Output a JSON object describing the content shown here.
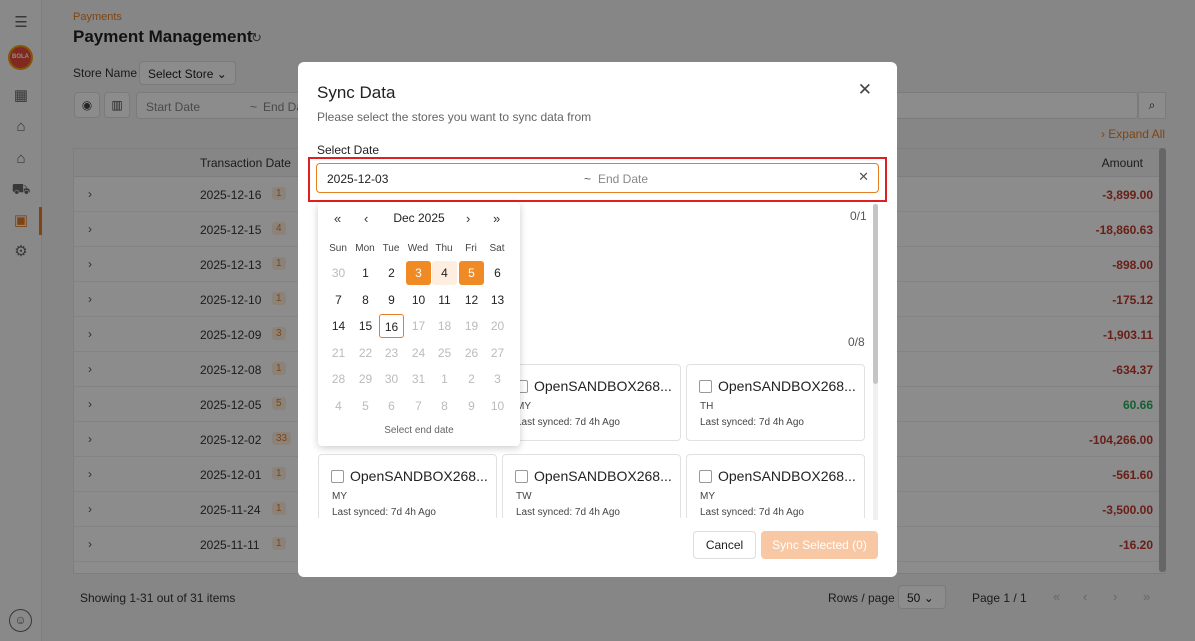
{
  "breadcrumb": "Payments",
  "page_title": "Payment Management",
  "filter": {
    "label": "Store Name",
    "select": "Select Store"
  },
  "date_filter": {
    "start": "Start Date",
    "sep": "~",
    "end": "End Da"
  },
  "expand_all": "Expand All",
  "table": {
    "headers": {
      "date": "Transaction Date",
      "amount": "Amount"
    },
    "rows": [
      {
        "date": "2025-12-16",
        "count": "1",
        "amount": "-3,899.00"
      },
      {
        "date": "2025-12-15",
        "count": "4",
        "amount": "-18,860.63"
      },
      {
        "date": "2025-12-13",
        "count": "1",
        "amount": "-898.00"
      },
      {
        "date": "2025-12-10",
        "count": "1",
        "amount": "-175.12"
      },
      {
        "date": "2025-12-09",
        "count": "3",
        "amount": "-1,903.11"
      },
      {
        "date": "2025-12-08",
        "count": "1",
        "amount": "-634.37"
      },
      {
        "date": "2025-12-05",
        "count": "5",
        "amount": "60.66"
      },
      {
        "date": "2025-12-02",
        "count": "33",
        "amount": "-104,266.00"
      },
      {
        "date": "2025-12-01",
        "count": "1",
        "amount": "-561.60"
      },
      {
        "date": "2025-11-24",
        "count": "1",
        "amount": "-3,500.00"
      },
      {
        "date": "2025-11-11",
        "count": "1",
        "amount": "-16.20"
      }
    ]
  },
  "footer": {
    "showing": "Showing 1-31 out of 31 items",
    "rows_label": "Rows / page",
    "rows_value": "50",
    "page": "Page 1 / 1"
  },
  "modal": {
    "title": "Sync Data",
    "subtitle": "Please select the stores you want to sync data from",
    "date_label": "Select Date",
    "date_start": "2025-12-03",
    "date_sep": "~",
    "date_end_placeholder": "End Date",
    "count1": "0/1",
    "count2": "0/8",
    "stores": [
      {
        "name": "OpenSANDBOX268...",
        "country": "MY",
        "sync": "Last synced: 7d 4h Ago"
      },
      {
        "name": "OpenSANDBOX268...",
        "country": "TH",
        "sync": "Last synced: 7d 4h Ago"
      },
      {
        "name": "OpenSANDBOX268...",
        "country": "MY",
        "sync": "Last synced: 7d 4h Ago"
      },
      {
        "name": "OpenSANDBOX268...",
        "country": "TW",
        "sync": "Last synced: 7d 4h Ago"
      },
      {
        "name": "OpenSANDBOX268...",
        "country": "MY",
        "sync": "Last synced: 7d 4h Ago"
      }
    ],
    "cancel": "Cancel",
    "sync_button": "Sync Selected (0)"
  },
  "calendar": {
    "month": "Dec 2025",
    "dow": [
      "Sun",
      "Mon",
      "Tue",
      "Wed",
      "Thu",
      "Fri",
      "Sat"
    ],
    "weeks": [
      [
        "30",
        "1",
        "2",
        "3",
        "4",
        "5",
        "6"
      ],
      [
        "7",
        "8",
        "9",
        "10",
        "11",
        "12",
        "13"
      ],
      [
        "14",
        "15",
        "16",
        "17",
        "18",
        "19",
        "20"
      ],
      [
        "21",
        "22",
        "23",
        "24",
        "25",
        "26",
        "27"
      ],
      [
        "28",
        "29",
        "30",
        "31",
        "1",
        "2",
        "3"
      ],
      [
        "4",
        "5",
        "6",
        "7",
        "8",
        "9",
        "10"
      ]
    ],
    "footer": "Select end date"
  },
  "colors": {
    "accent": "#e67e22",
    "negative": "#c0392b",
    "positive": "#27ae60",
    "highlight": "#e02020"
  }
}
